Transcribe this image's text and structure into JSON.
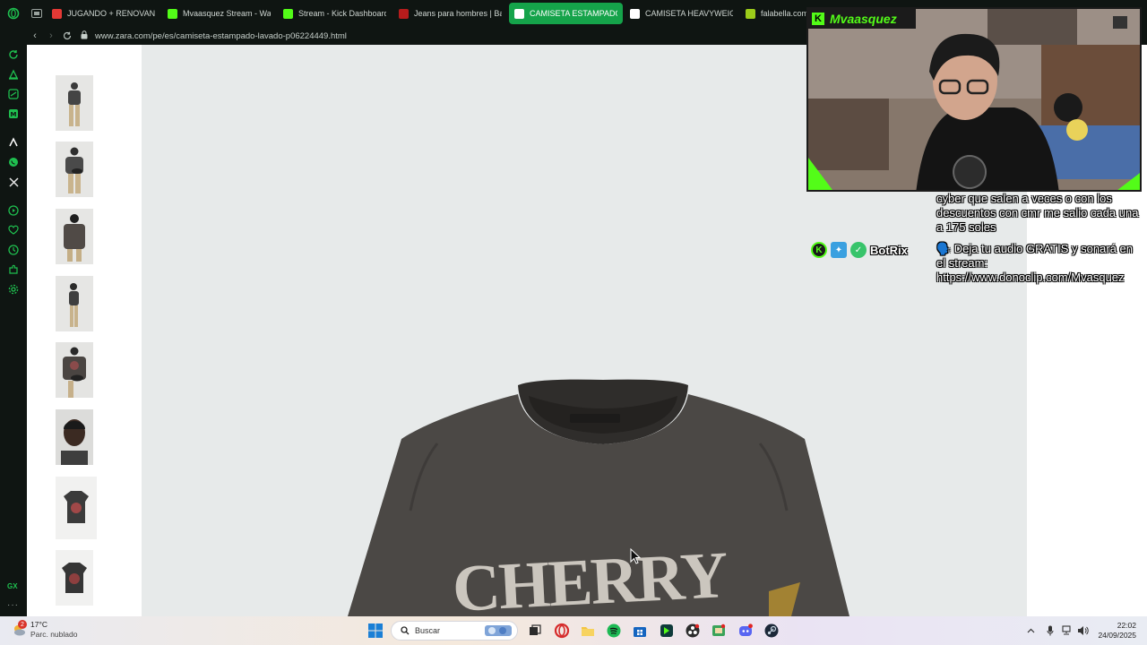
{
  "browser": {
    "tabs": [
      {
        "label": "JUGANDO + RENOVANDO",
        "fav_color": "#e53935",
        "active": false
      },
      {
        "label": "Mvaasquez Stream - Wa",
        "fav_color": "#53fc18",
        "active": false
      },
      {
        "label": "Stream - Kick Dashboard",
        "fav_color": "#53fc18",
        "active": false
      },
      {
        "label": "Jeans para hombres | Ba",
        "fav_color": "#b71c1c",
        "active": false
      },
      {
        "label": "CAMISETA ESTAMPADO",
        "fav_color": "#ffffff",
        "active": true
      },
      {
        "label": "CAMISETA HEAVYWEIGH",
        "fav_color": "#ffffff",
        "active": false
      },
      {
        "label": "falabella.com",
        "fav_color": "#9ccc1a",
        "active": false
      }
    ],
    "url": "www.zara.com/pe/es/camiseta-estampado-lavado-p06224449.html",
    "accent": "#15a34a"
  },
  "product": {
    "print_text": "CHERRY"
  },
  "stream": {
    "streamer_name": "Mvaasquez",
    "kick_letter": "K",
    "chat": [
      {
        "text": "cyber que salen a veces o con los descuentos con cmr me salio cada una a 175 soles"
      },
      {
        "bot": "BotRix",
        "text": "🗣️ Deja tu audio GRATIS y sonará en el stream: https://www.donoclip.com/Mvasquez"
      }
    ]
  },
  "taskbar": {
    "weather_temp": "17°C",
    "weather_desc": "Parc. nublado",
    "weather_badge": "2",
    "search_placeholder": "Buscar",
    "time": "22:02",
    "date": "24/09/2025"
  }
}
